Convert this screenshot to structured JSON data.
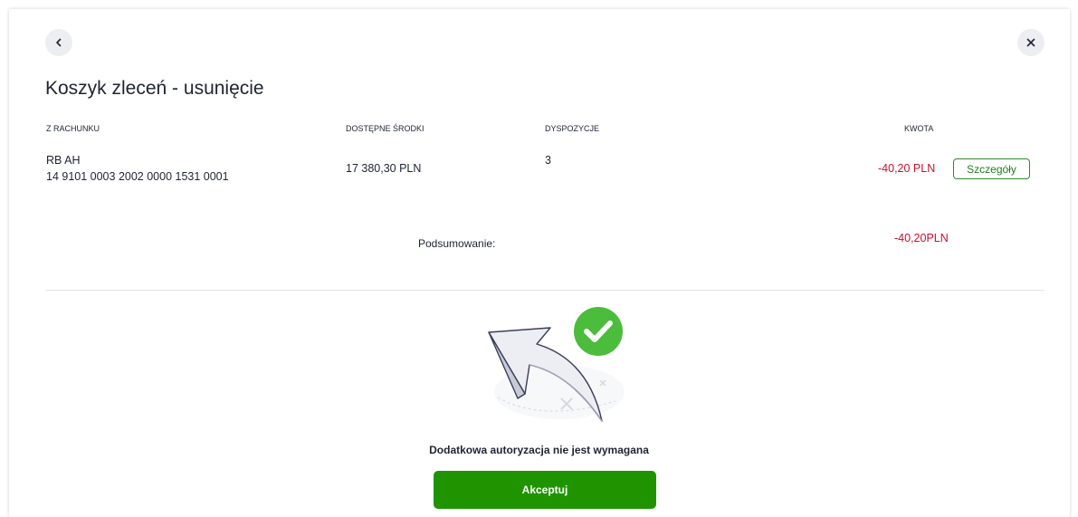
{
  "header": {
    "back_icon": "chevron-left-icon",
    "close_icon": "close-icon",
    "title": "Koszyk zleceń - usunięcie"
  },
  "table": {
    "columns": {
      "account": "Z RACHUNKU",
      "available": "DOSTĘPNE ŚRODKI",
      "orders": "DYSPOZYCJE",
      "amount": "KWOTA"
    },
    "row": {
      "account_name": "RB AH",
      "account_number": "14 9101 0003 2002 0000 1531 0001",
      "available": "17 380,30 PLN",
      "orders": "3",
      "amount": "-40,20 PLN",
      "details_label": "Szczegóły"
    }
  },
  "summary": {
    "label": "Podsumowanie:",
    "amount": "-40,20PLN"
  },
  "confirmation": {
    "illustration_icon": "return-arrow-check-icon",
    "message": "Dodatkowa autoryzacja nie jest wymagana",
    "accept_label": "Akceptuj"
  },
  "colors": {
    "accent_green": "#1f9400",
    "negative_amount": "#c4122f",
    "check_green": "#4cbc3c"
  }
}
